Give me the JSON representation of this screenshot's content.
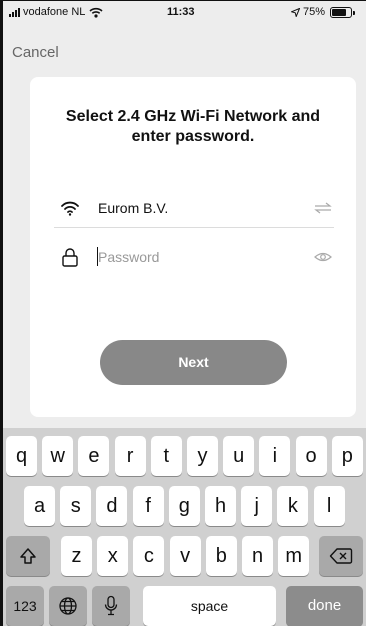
{
  "status_bar": {
    "carrier": "vodafone NL",
    "time": "11:33",
    "battery": "75%",
    "battery_level": 0.75
  },
  "nav": {
    "cancel_label": "Cancel"
  },
  "card": {
    "title": "Select 2.4 GHz Wi-Fi Network and enter password.",
    "network_name": "Eurom B.V.",
    "password_placeholder": "Password",
    "next_label": "Next"
  },
  "keyboard": {
    "row1": [
      "q",
      "w",
      "e",
      "r",
      "t",
      "y",
      "u",
      "i",
      "o",
      "p"
    ],
    "row2": [
      "a",
      "s",
      "d",
      "f",
      "g",
      "h",
      "j",
      "k",
      "l"
    ],
    "row3": [
      "z",
      "x",
      "c",
      "v",
      "b",
      "n",
      "m"
    ],
    "numbers_label": "123",
    "space_label": "space",
    "done_label": "done",
    "icons": {
      "shift": "shift-icon",
      "backspace": "backspace-icon",
      "globe": "globe-icon",
      "mic": "microphone-icon"
    }
  }
}
